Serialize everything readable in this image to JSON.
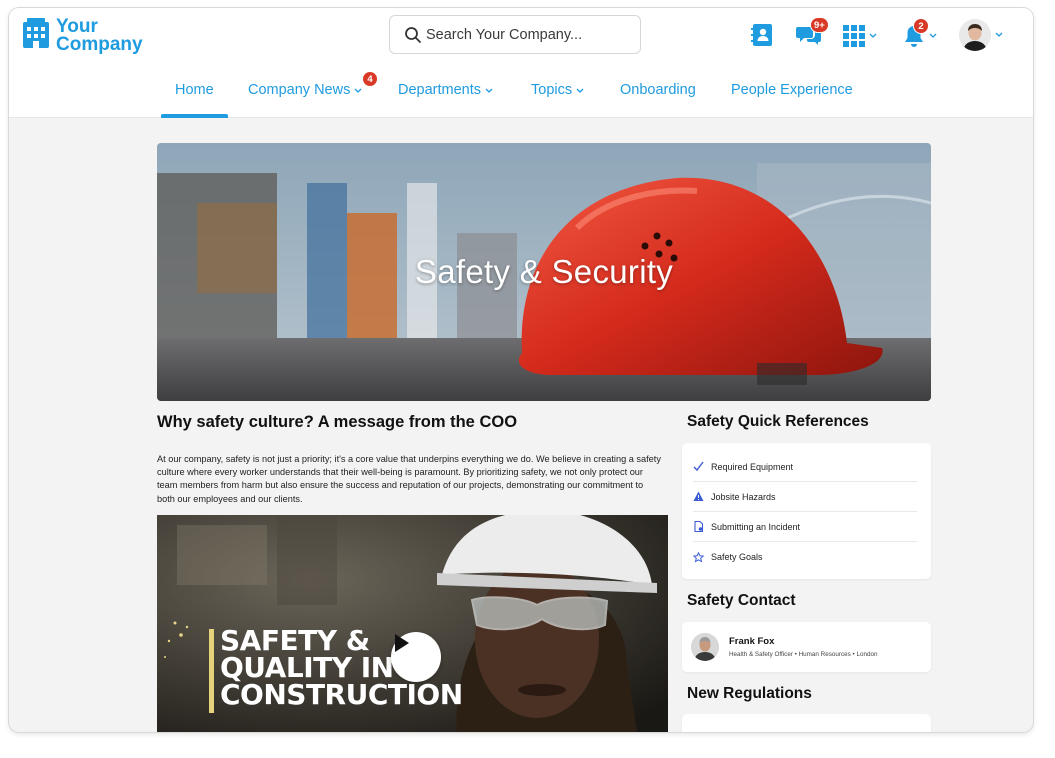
{
  "brand": {
    "line1": "Your",
    "line2": "Company",
    "color": "#1f9be0"
  },
  "search": {
    "placeholder": "Search Your Company..."
  },
  "header_icons": {
    "directory": "contact-book-icon",
    "chat": "chat-bubbles-icon",
    "chat_badge": "9+",
    "apps": "app-grid-icon",
    "notifications": "bell-icon",
    "notifications_badge": "2",
    "avatar": "user-avatar"
  },
  "nav": {
    "items": [
      {
        "label": "Home",
        "active": true
      },
      {
        "label": "Company News",
        "badge": "4",
        "dropdown": true
      },
      {
        "label": "Departments",
        "dropdown": true
      },
      {
        "label": "Topics",
        "dropdown": true
      },
      {
        "label": "Onboarding"
      },
      {
        "label": "People Experience"
      }
    ]
  },
  "hero": {
    "title": "Safety & Security"
  },
  "article": {
    "title": "Why safety culture? A message from the COO",
    "body": "At our company, safety is not just a priority; it's a core value that underpins everything we do. We believe in creating a safety culture where every worker understands that their well-being is paramount. By prioritizing safety, we not only protect our team members from harm but also ensure the success and reputation of our projects, demonstrating our commitment to both our employees and our clients."
  },
  "video": {
    "line1": "SAFETY &",
    "line2": "QUALITY IN",
    "line3": "CONSTRUCTION",
    "play_icon": "play-icon"
  },
  "quick_refs": {
    "heading": "Safety Quick References",
    "items": [
      {
        "label": "Required Equipment",
        "icon": "checkmark-icon"
      },
      {
        "label": "Jobsite Hazards",
        "icon": "warning-triangle-icon"
      },
      {
        "label": "Submitting an Incident",
        "icon": "document-icon"
      },
      {
        "label": "Safety Goals",
        "icon": "star-icon"
      }
    ]
  },
  "contact": {
    "heading": "Safety Contact",
    "name": "Frank Fox",
    "role": "Health & Safety Officer • Human Resources • London"
  },
  "regulations": {
    "heading": "New Regulations"
  },
  "colors": {
    "accent": "#1f9be0",
    "badge": "#d93a28",
    "icon_blue": "#3b5bd6"
  }
}
